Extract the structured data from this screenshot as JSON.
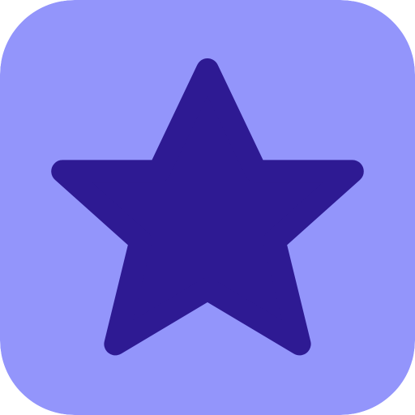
{
  "icon": {
    "name": "star-icon",
    "background_color": "#9395fb",
    "star_color": "#2e1a93"
  }
}
